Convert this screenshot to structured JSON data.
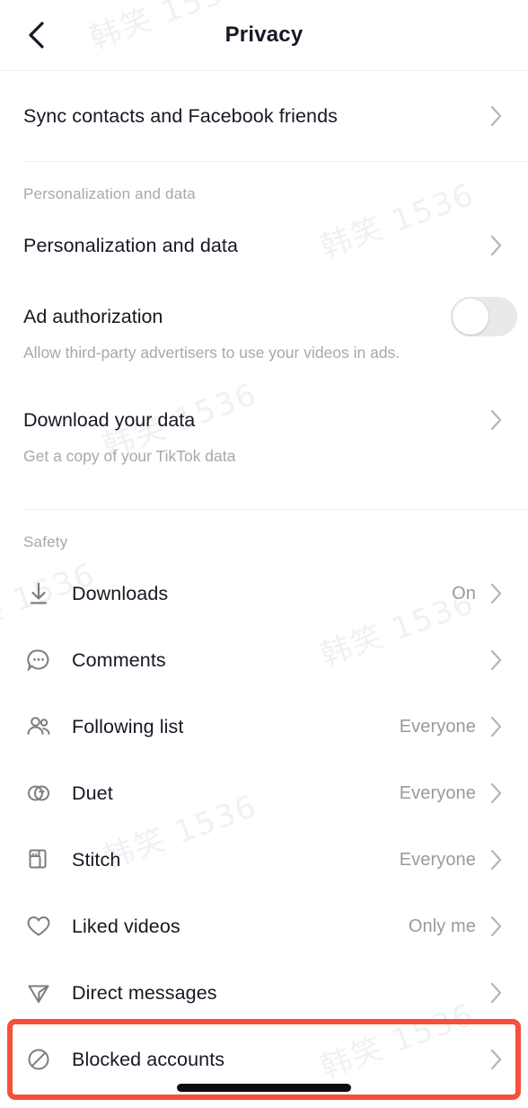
{
  "header": {
    "title": "Privacy",
    "back_icon": "chevron-left-icon"
  },
  "watermark": {
    "text": "韩笑 1536"
  },
  "top_section": {
    "rows": [
      {
        "label": "Sync contacts and Facebook friends",
        "chevron": "chevron-right-icon"
      }
    ]
  },
  "personalization_section": {
    "title": "Personalization and data",
    "rows": [
      {
        "label": "Personalization and data",
        "chevron": "chevron-right-icon"
      }
    ],
    "ad_authorization": {
      "label": "Ad authorization",
      "subtitle": "Allow third-party advertisers to use your videos in ads.",
      "toggle_state": "off"
    },
    "download_data": {
      "label": "Download your data",
      "subtitle": "Get a copy of your TikTok data",
      "chevron": "chevron-right-icon"
    }
  },
  "safety_section": {
    "title": "Safety",
    "rows": [
      {
        "icon": "download-icon",
        "label": "Downloads",
        "value": "On",
        "chevron": "chevron-right-icon",
        "highlighted": false
      },
      {
        "icon": "comment-bubble-icon",
        "label": "Comments",
        "value": "",
        "chevron": "chevron-right-icon",
        "highlighted": false
      },
      {
        "icon": "people-icon",
        "label": "Following list",
        "value": "Everyone",
        "chevron": "chevron-right-icon",
        "highlighted": false
      },
      {
        "icon": "duet-icon",
        "label": "Duet",
        "value": "Everyone",
        "chevron": "chevron-right-icon",
        "highlighted": false
      },
      {
        "icon": "stitch-icon",
        "label": "Stitch",
        "value": "Everyone",
        "chevron": "chevron-right-icon",
        "highlighted": false
      },
      {
        "icon": "heart-icon",
        "label": "Liked videos",
        "value": "Only me",
        "chevron": "chevron-right-icon",
        "highlighted": false
      },
      {
        "icon": "send-icon",
        "label": "Direct messages",
        "value": "",
        "chevron": "chevron-right-icon",
        "highlighted": false
      },
      {
        "icon": "block-icon",
        "label": "Blocked accounts",
        "value": "",
        "chevron": "chevron-right-icon",
        "highlighted": true
      }
    ]
  },
  "colors": {
    "highlight": "#f4503c",
    "text_primary": "#161823",
    "text_secondary": "#a8a8ac",
    "divider": "#f0f0f0"
  }
}
